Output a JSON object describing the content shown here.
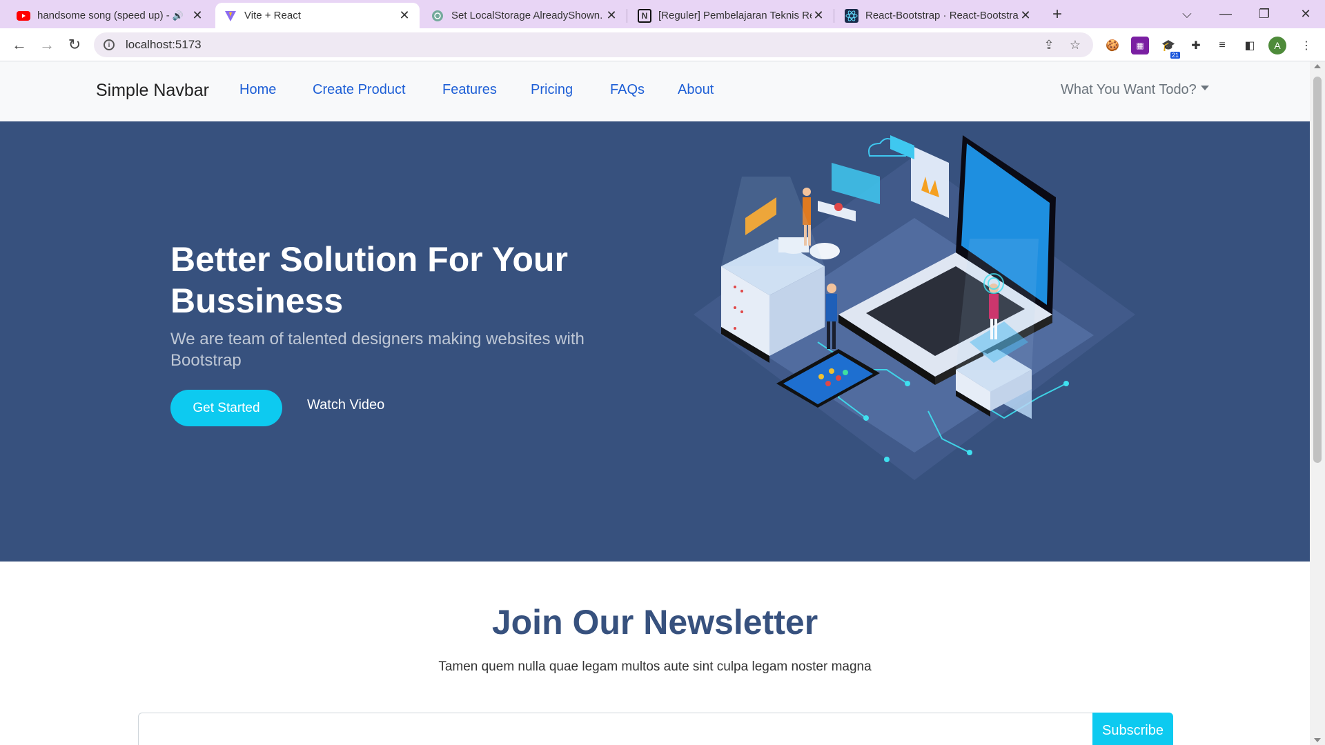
{
  "browser": {
    "tabs": [
      {
        "title": "handsome song (speed up) -",
        "icon": "youtube-icon",
        "audio": true
      },
      {
        "title": "Vite + React",
        "icon": "vite-icon",
        "active": true
      },
      {
        "title": "Set LocalStorage AlreadyShown.",
        "icon": "chatgpt-icon"
      },
      {
        "title": "[Reguler] Pembelajaran Teknis Re",
        "icon": "notion-icon"
      },
      {
        "title": "React-Bootstrap · React-Bootstrap",
        "icon": "react-bootstrap-icon"
      }
    ],
    "url": "localhost:5173",
    "extension_badge": "21",
    "profile_initial": "A"
  },
  "navbar": {
    "brand": "Simple Navbar",
    "links": [
      "Home",
      "Create Product",
      "Features",
      "Pricing",
      "FAQs",
      "About"
    ],
    "dropdown_label": "What You Want Todo?"
  },
  "hero": {
    "title": "Better Solution For Your Bussiness",
    "subtitle": "We are team of talented designers making websites with Bootstrap",
    "primary_button": "Get Started",
    "secondary_button": "Watch Video",
    "background_color": "#37517e",
    "accent_color": "#0dcaf0"
  },
  "newsletter": {
    "title": "Join Our Newsletter",
    "description": "Tamen quem nulla quae legam multos aute sint culpa legam noster magna",
    "input_value": "",
    "button_label": "Subscribe"
  }
}
